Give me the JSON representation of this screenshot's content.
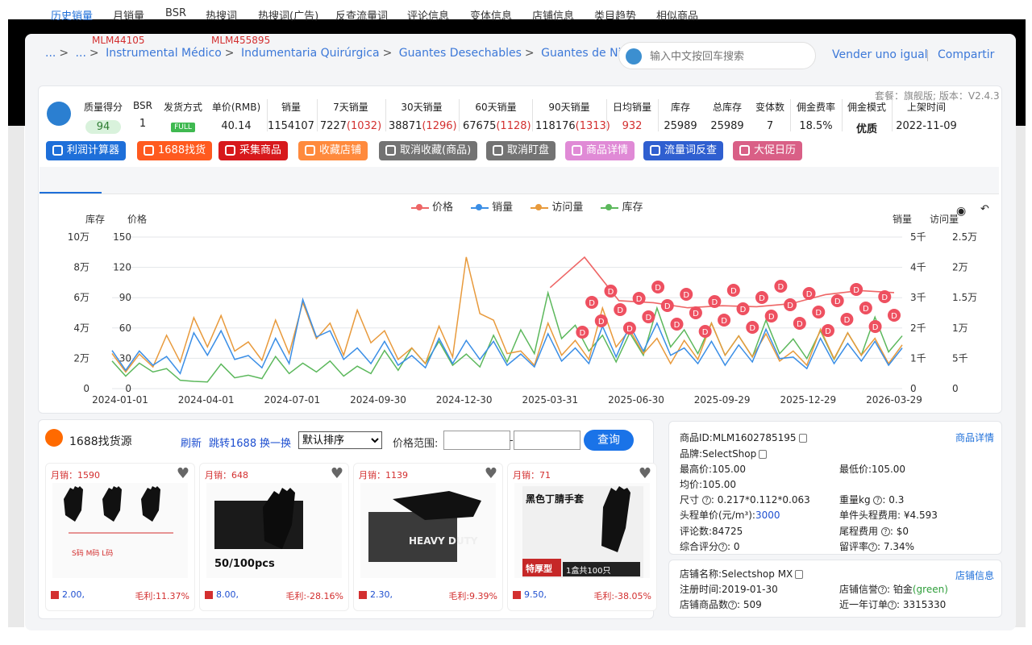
{
  "breadcrumbs": {
    "items": [
      "...",
      "...",
      "Instrumental Médico",
      "Indumentaria Quirúrgica",
      "Guantes Desechables",
      "Guantes de Nitrilo"
    ],
    "ids": [
      "MLM44105",
      "MLM455895"
    ],
    "sep": ">"
  },
  "search": {
    "placeholder": "输入中文按回车搜索"
  },
  "header_links": {
    "sell": "Vender uno igual",
    "share": "Compartir"
  },
  "version": "套餐：旗舰版; 版本：V2.4.3",
  "stats": [
    {
      "label": "质量得分",
      "value": "94"
    },
    {
      "label": "BSR",
      "value": "1"
    },
    {
      "label": "发货方式",
      "value": "FULL"
    },
    {
      "label": "单价(RMB)",
      "value": "40.14"
    },
    {
      "label": "销量",
      "value": "1154107"
    },
    {
      "label": "7天销量",
      "value": "7227",
      "extra": "(1032)"
    },
    {
      "label": "30天销量",
      "value": "38871",
      "extra": "(1296)"
    },
    {
      "label": "60天销量",
      "value": "67675",
      "extra": "(1128)"
    },
    {
      "label": "90天销量",
      "value": "118176",
      "extra": "(1313)"
    },
    {
      "label": "日均销量",
      "value": "932"
    },
    {
      "label": "库存",
      "value": "25989"
    },
    {
      "label": "总库存",
      "value": "25989"
    },
    {
      "label": "变体数",
      "value": "7"
    },
    {
      "label": "佣金费率",
      "value": "18.5%"
    },
    {
      "label": "佣金模式",
      "value": "优质"
    },
    {
      "label": "上架时间",
      "value": "2022-11-09"
    }
  ],
  "buttons": [
    {
      "label": "利润计算器",
      "color": "#1e6fd9"
    },
    {
      "label": "1688找货",
      "color": "#ff5a1f"
    },
    {
      "label": "采集商品",
      "color": "#d7191c"
    },
    {
      "label": "收藏店铺",
      "color": "#ff8a3d"
    },
    {
      "label": "取消收藏(商品)",
      "color": "#737373"
    },
    {
      "label": "取消盯盘",
      "color": "#737373"
    },
    {
      "label": "商品详情",
      "color": "#e08ad6"
    },
    {
      "label": "流量词反查",
      "color": "#2f5fd0"
    },
    {
      "label": "大促日历",
      "color": "#d95f86"
    }
  ],
  "tabs": [
    "历史销量",
    "月销量",
    "BSR",
    "热搜词",
    "热搜词(广告)",
    "反查流量词",
    "评论信息",
    "变体信息",
    "店铺信息",
    "类目趋势",
    "相似商品"
  ],
  "active_tab": "历史销量",
  "chart_data": {
    "type": "line",
    "legend": [
      "价格",
      "销量",
      "访问量",
      "库存"
    ],
    "colors": {
      "价格": "#ee6666",
      "销量": "#3a8ee6",
      "访问量": "#e89a3c",
      "库存": "#5cb85c"
    },
    "left_axis_labels": {
      "stock": "库存",
      "price": "价格"
    },
    "right_axis_labels": {
      "sales": "销量",
      "visits": "访问量"
    },
    "y_stock_ticks": [
      "10万",
      "8万",
      "6万",
      "4万",
      "2万",
      "0"
    ],
    "y_price_ticks": [
      "150",
      "120",
      "90",
      "60",
      "30",
      "0"
    ],
    "y_sales_ticks": [
      "5千",
      "4千",
      "3千",
      "2千",
      "1千",
      "0"
    ],
    "y_visits_ticks": [
      "2.5万",
      "2万",
      "1.5万",
      "1万",
      "5千",
      "0"
    ],
    "x_ticks": [
      "2024-01-01",
      "2024-04-01",
      "2024-07-01",
      "2024-09-30",
      "2024-12-30",
      "2025-03-31",
      "2025-06-30",
      "2025-09-29",
      "2025-12-29",
      "2026-03-29"
    ],
    "price_ylim": [
      0,
      150
    ],
    "series_price_flat": {
      "start": "2025-03-31",
      "end": "2026-03-29",
      "values": [
        100,
        130,
        87,
        85,
        80,
        82,
        81,
        84,
        93,
        97,
        95
      ]
    },
    "series_stock": [
      15,
      20,
      10,
      8,
      13,
      12,
      18,
      20,
      15,
      18,
      22,
      30,
      28,
      26,
      32,
      42,
      60,
      45,
      32,
      40,
      50,
      42,
      40,
      38,
      42,
      36,
      35,
      40,
      44,
      38
    ],
    "series_sales": [
      22,
      28,
      18,
      40,
      35,
      25,
      30,
      62,
      35,
      30,
      28,
      25,
      30,
      35,
      28,
      26,
      33,
      30,
      38,
      45,
      40,
      30,
      28,
      32,
      36,
      24,
      30,
      33,
      28,
      30
    ],
    "series_visits": [
      20,
      26,
      32,
      50,
      45,
      34,
      42,
      60,
      40,
      55,
      35,
      30,
      38,
      90,
      42,
      28,
      40,
      35,
      50,
      42,
      30,
      35,
      40,
      38,
      33,
      28,
      36,
      40,
      30,
      32
    ],
    "marker_label": "D"
  },
  "finder": {
    "title": "1688找货源",
    "refresh": "刷新",
    "jump": "跳转1688",
    "swap": "换一换",
    "sort_selected": "默认排序",
    "price_range_label": "价格范围:",
    "query": "查询",
    "dash": "-"
  },
  "products": [
    {
      "sales": "月销：1590",
      "price": "2.00,",
      "profit": "毛利:11.37%",
      "img_text": "S码  M码  L码"
    },
    {
      "sales": "月销：648",
      "price": "8.00,",
      "profit": "毛利:-28.16%",
      "img_text": "50/100pcs"
    },
    {
      "sales": "月销：1139",
      "price": "2.30,",
      "profit": "毛利:9.39%",
      "img_text": "HEAVY DUTY"
    },
    {
      "sales": "月销：71",
      "price": "9.50,",
      "profit": "毛利:-38.05%",
      "img_text": "黑色丁腈手套",
      "img_text2": "特厚型",
      "img_text3": "1盒共100只"
    }
  ],
  "product_info": {
    "id": "商品ID:MLM1602785195",
    "detail_link": "商品详情",
    "brand": "品牌:SelectShop",
    "max_price": "最高价:105.00",
    "min_price": "最低价:105.00",
    "avg_price": "均价:105.00",
    "size_label": "尺寸",
    "size_value": ": 0.217*0.112*0.063",
    "weight_label": "重量kg",
    "weight_value": ": 0.3",
    "head_unit_label": "头程单价(元/m³):",
    "head_unit_value": "3000",
    "unit_head_cost": "单件头程费用: ¥4.593",
    "reviews": "评论数:84725",
    "tail_label": "尾程费用",
    "tail_value": ": $0",
    "rating_label": "综合评分",
    "rating_value": ": 0",
    "retention_label": "留评率",
    "retention_value": ": 7.34%"
  },
  "store_info": {
    "name": "店铺名称:Selectshop MX",
    "link": "店铺信息",
    "reg": "注册时间:2019-01-30",
    "rep_label": "店铺信誉",
    "rep_value": ": 铂金",
    "rep_color": "(green)",
    "count_label": "店铺商品数",
    "count_value": ": 509",
    "orders_label": "近一年订单",
    "orders_value": ": 3315330"
  }
}
